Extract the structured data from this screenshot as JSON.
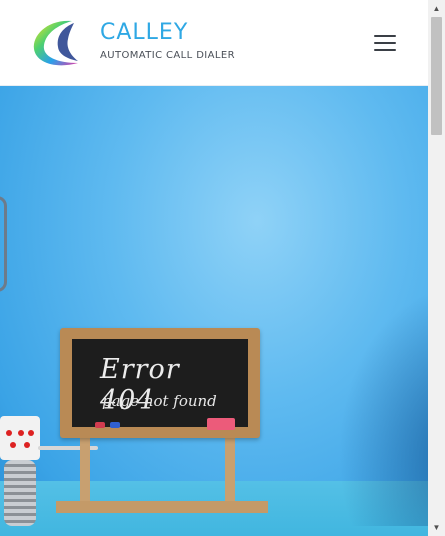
{
  "header": {
    "brand_name": "CALLEY",
    "brand_tagline": "AUTOMATIC CALL DIALER",
    "menu_icon": "hamburger-menu-icon"
  },
  "hero": {
    "sign_title": "Error 404",
    "sign_subtitle": "page not found"
  },
  "scrollbar": {
    "up_glyph": "▲",
    "down_glyph": "▼"
  },
  "colors": {
    "brand_blue": "#2fa8e4",
    "hero_sky": "#5fbaf0"
  }
}
